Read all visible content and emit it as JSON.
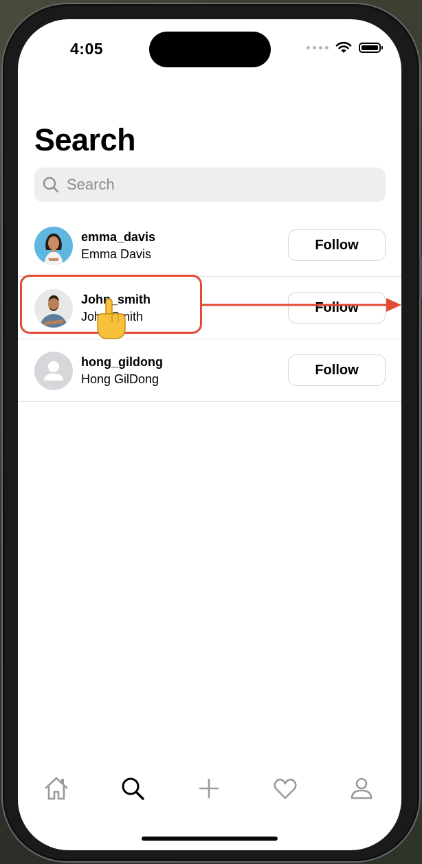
{
  "status_bar": {
    "time": "4:05"
  },
  "page": {
    "title": "Search"
  },
  "search": {
    "placeholder": "Search"
  },
  "users": [
    {
      "username": "emma_davis",
      "full_name": "Emma Davis",
      "button": "Follow"
    },
    {
      "username": "John_smith",
      "full_name": "John Smith",
      "button": "Follow"
    },
    {
      "username": "hong_gildong",
      "full_name": "Hong GilDong",
      "button": "Follow"
    }
  ],
  "tab_bar": {
    "items": [
      "home-icon",
      "search-icon",
      "plus-icon",
      "heart-icon",
      "person-icon"
    ],
    "active": "search-icon"
  },
  "colors": {
    "annotation": "#e24a33",
    "search_bg": "#eeeeee",
    "inactive_icon": "#9a9a9a"
  }
}
